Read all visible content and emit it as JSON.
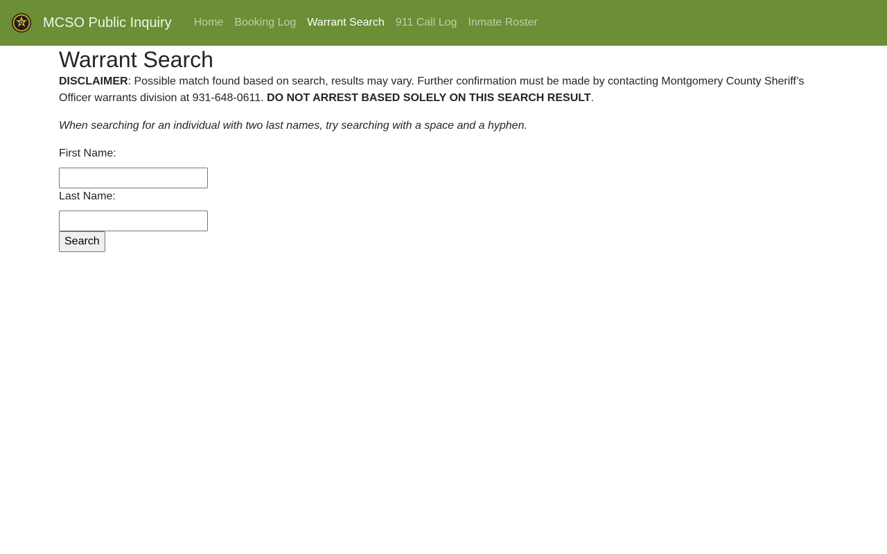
{
  "nav": {
    "brand_title": "MCSO Public Inquiry",
    "logo_icon": "sheriff-star-badge-icon",
    "items": [
      {
        "label": "Home",
        "active": false
      },
      {
        "label": "Booking Log",
        "active": false
      },
      {
        "label": "Warrant Search",
        "active": true
      },
      {
        "label": "911 Call Log",
        "active": false
      },
      {
        "label": "Inmate Roster",
        "active": false
      }
    ]
  },
  "main": {
    "title": "Warrant Search",
    "disclaimer": {
      "label": "DISCLAIMER",
      "text": ": Possible match found based on search, results may vary. Further confirmation must be made by contacting Montgomery County Sheriff’s Officer warrants division at 931-648-0611. ",
      "warning": "DO NOT ARREST BASED SOLELY ON THIS SEARCH RESULT",
      "end": "."
    },
    "hint": "When searching for an individual with two last names, try searching with a space and a hyphen.",
    "form": {
      "first_name_label": "First Name:",
      "first_name_value": "",
      "last_name_label": "Last Name:",
      "last_name_value": "",
      "search_button": "Search"
    }
  },
  "colors": {
    "navbar_bg": "#6b8e36",
    "nav_link": "#c1d0a6",
    "nav_link_active": "#ffffff"
  }
}
